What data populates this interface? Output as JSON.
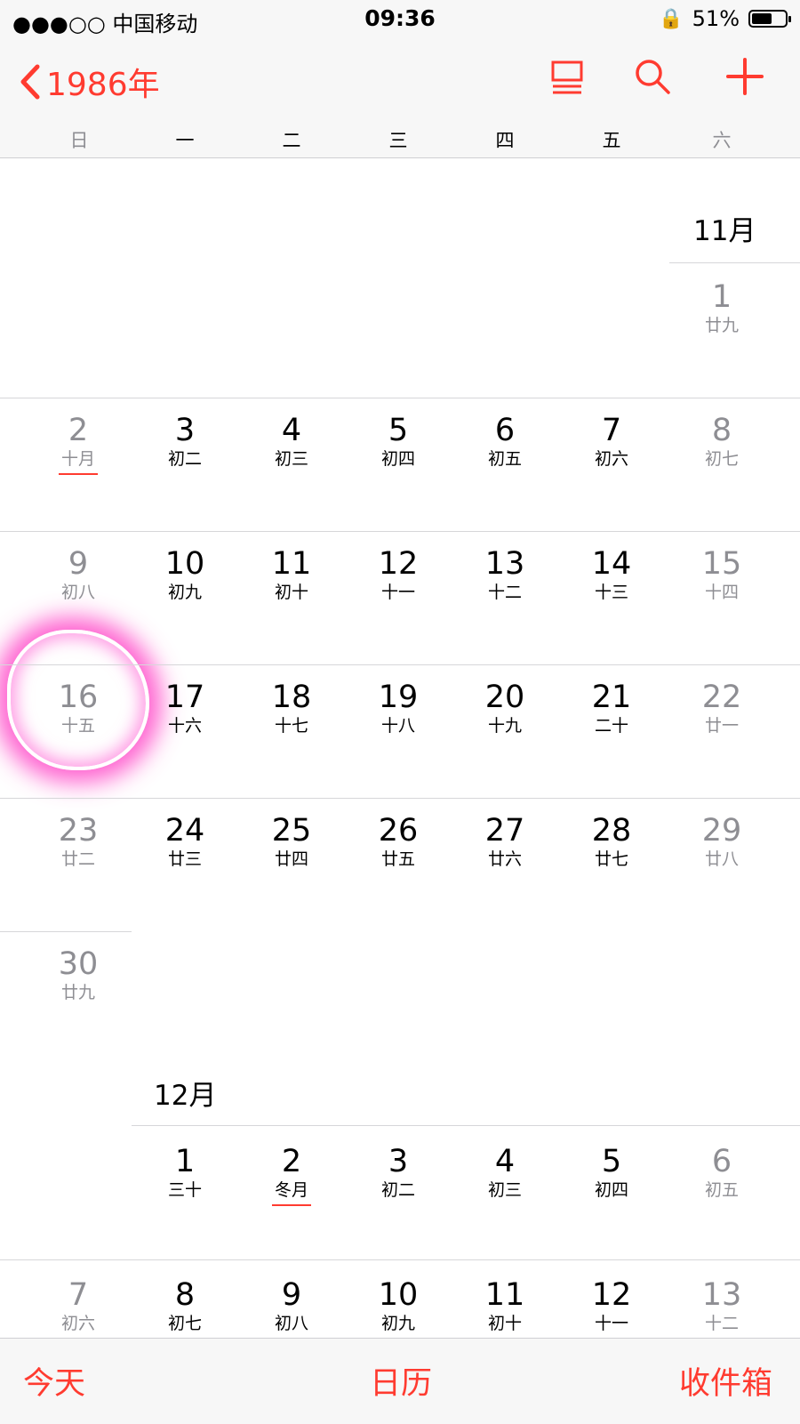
{
  "status": {
    "signal": "●●●○○ 中国移动",
    "time": "09:36",
    "battery": "51%"
  },
  "nav": {
    "back_label": "1986年",
    "weekdays": [
      "日",
      "一",
      "二",
      "三",
      "四",
      "五",
      "六"
    ]
  },
  "calendar": {
    "months": [
      {
        "label": "11月",
        "days": [
          {
            "n": "1",
            "l": "廿九"
          },
          {
            "n": "2",
            "l": "十月"
          },
          {
            "n": "3",
            "l": "初二"
          },
          {
            "n": "4",
            "l": "初三"
          },
          {
            "n": "5",
            "l": "初四"
          },
          {
            "n": "6",
            "l": "初五"
          },
          {
            "n": "7",
            "l": "初六"
          },
          {
            "n": "8",
            "l": "初七"
          },
          {
            "n": "9",
            "l": "初八"
          },
          {
            "n": "10",
            "l": "初九"
          },
          {
            "n": "11",
            "l": "初十"
          },
          {
            "n": "12",
            "l": "十一"
          },
          {
            "n": "13",
            "l": "十二"
          },
          {
            "n": "14",
            "l": "十三"
          },
          {
            "n": "15",
            "l": "十四"
          },
          {
            "n": "16",
            "l": "十五"
          },
          {
            "n": "17",
            "l": "十六"
          },
          {
            "n": "18",
            "l": "十七"
          },
          {
            "n": "19",
            "l": "十八"
          },
          {
            "n": "20",
            "l": "十九"
          },
          {
            "n": "21",
            "l": "二十"
          },
          {
            "n": "22",
            "l": "廿一"
          },
          {
            "n": "23",
            "l": "廿二"
          },
          {
            "n": "24",
            "l": "廿三"
          },
          {
            "n": "25",
            "l": "廿四"
          },
          {
            "n": "26",
            "l": "廿五"
          },
          {
            "n": "27",
            "l": "廿六"
          },
          {
            "n": "28",
            "l": "廿七"
          },
          {
            "n": "29",
            "l": "廿八"
          },
          {
            "n": "30",
            "l": "廿九"
          }
        ]
      },
      {
        "label": "12月",
        "days": [
          {
            "n": "1",
            "l": "三十"
          },
          {
            "n": "2",
            "l": "冬月"
          },
          {
            "n": "3",
            "l": "初二"
          },
          {
            "n": "4",
            "l": "初三"
          },
          {
            "n": "5",
            "l": "初四"
          },
          {
            "n": "6",
            "l": "初五"
          },
          {
            "n": "7",
            "l": "初六"
          },
          {
            "n": "8",
            "l": "初七"
          },
          {
            "n": "9",
            "l": "初八"
          },
          {
            "n": "10",
            "l": "初九"
          },
          {
            "n": "11",
            "l": "初十"
          },
          {
            "n": "12",
            "l": "十一"
          },
          {
            "n": "13",
            "l": "十二"
          }
        ]
      }
    ],
    "highlighted_day": "16"
  },
  "tabs": {
    "today": "今天",
    "calendars": "日历",
    "inbox": "收件箱"
  },
  "colors": {
    "accent": "#ff3b30",
    "weekend": "#8e8e93",
    "highlight": "#ff46c8"
  }
}
